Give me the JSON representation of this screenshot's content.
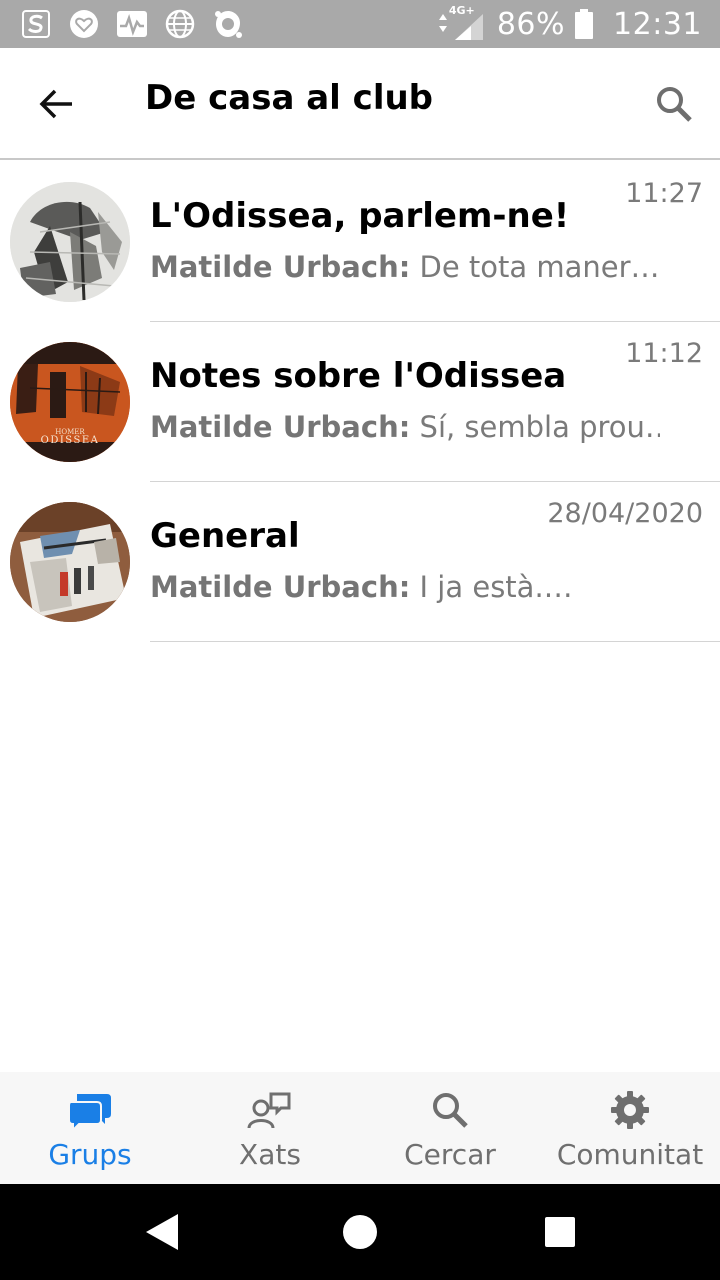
{
  "status_bar": {
    "network": "4G+",
    "battery": "86%",
    "time": "12:31",
    "icons": [
      "s-logo-icon",
      "heart-badge-icon",
      "activity-icon",
      "globe-icon",
      "avast-icon",
      "data-arrows-icon",
      "signal-icon",
      "battery-icon"
    ]
  },
  "app_bar": {
    "title": "De casa al club",
    "back_icon": "arrow-left-icon",
    "search_icon": "search-icon"
  },
  "groups": [
    {
      "name": "L'Odissea, parlem-ne!",
      "time": "11:27",
      "author": "Matilde Urbach:",
      "message": "De tota maner…",
      "avatar": "sketch-drawing"
    },
    {
      "name": "Notes sobre l'Odissea",
      "time": "11:12",
      "author": "Matilde Urbach:",
      "message": "Sí, sembla prou…",
      "avatar": "book-cover",
      "avatar_text": [
        "HOMER",
        "ODISSEA"
      ]
    },
    {
      "name": "General",
      "time": "28/04/2020",
      "author": "Matilde Urbach:",
      "message": "I ja està.…",
      "avatar": "photo-book"
    }
  ],
  "bottom_nav": [
    {
      "label": "Grups",
      "icon": "chat-bubbles-icon",
      "active": true
    },
    {
      "label": "Xats",
      "icon": "person-chat-icon",
      "active": false
    },
    {
      "label": "Cercar",
      "icon": "search-icon",
      "active": false
    },
    {
      "label": "Comunitat",
      "icon": "gear-icon",
      "active": false
    }
  ],
  "colors": {
    "accent": "#1a7fe6",
    "status_bar": "#a9a9a9",
    "secondary_text": "#7a7a7a",
    "nav_background": "#f7f7f7"
  }
}
